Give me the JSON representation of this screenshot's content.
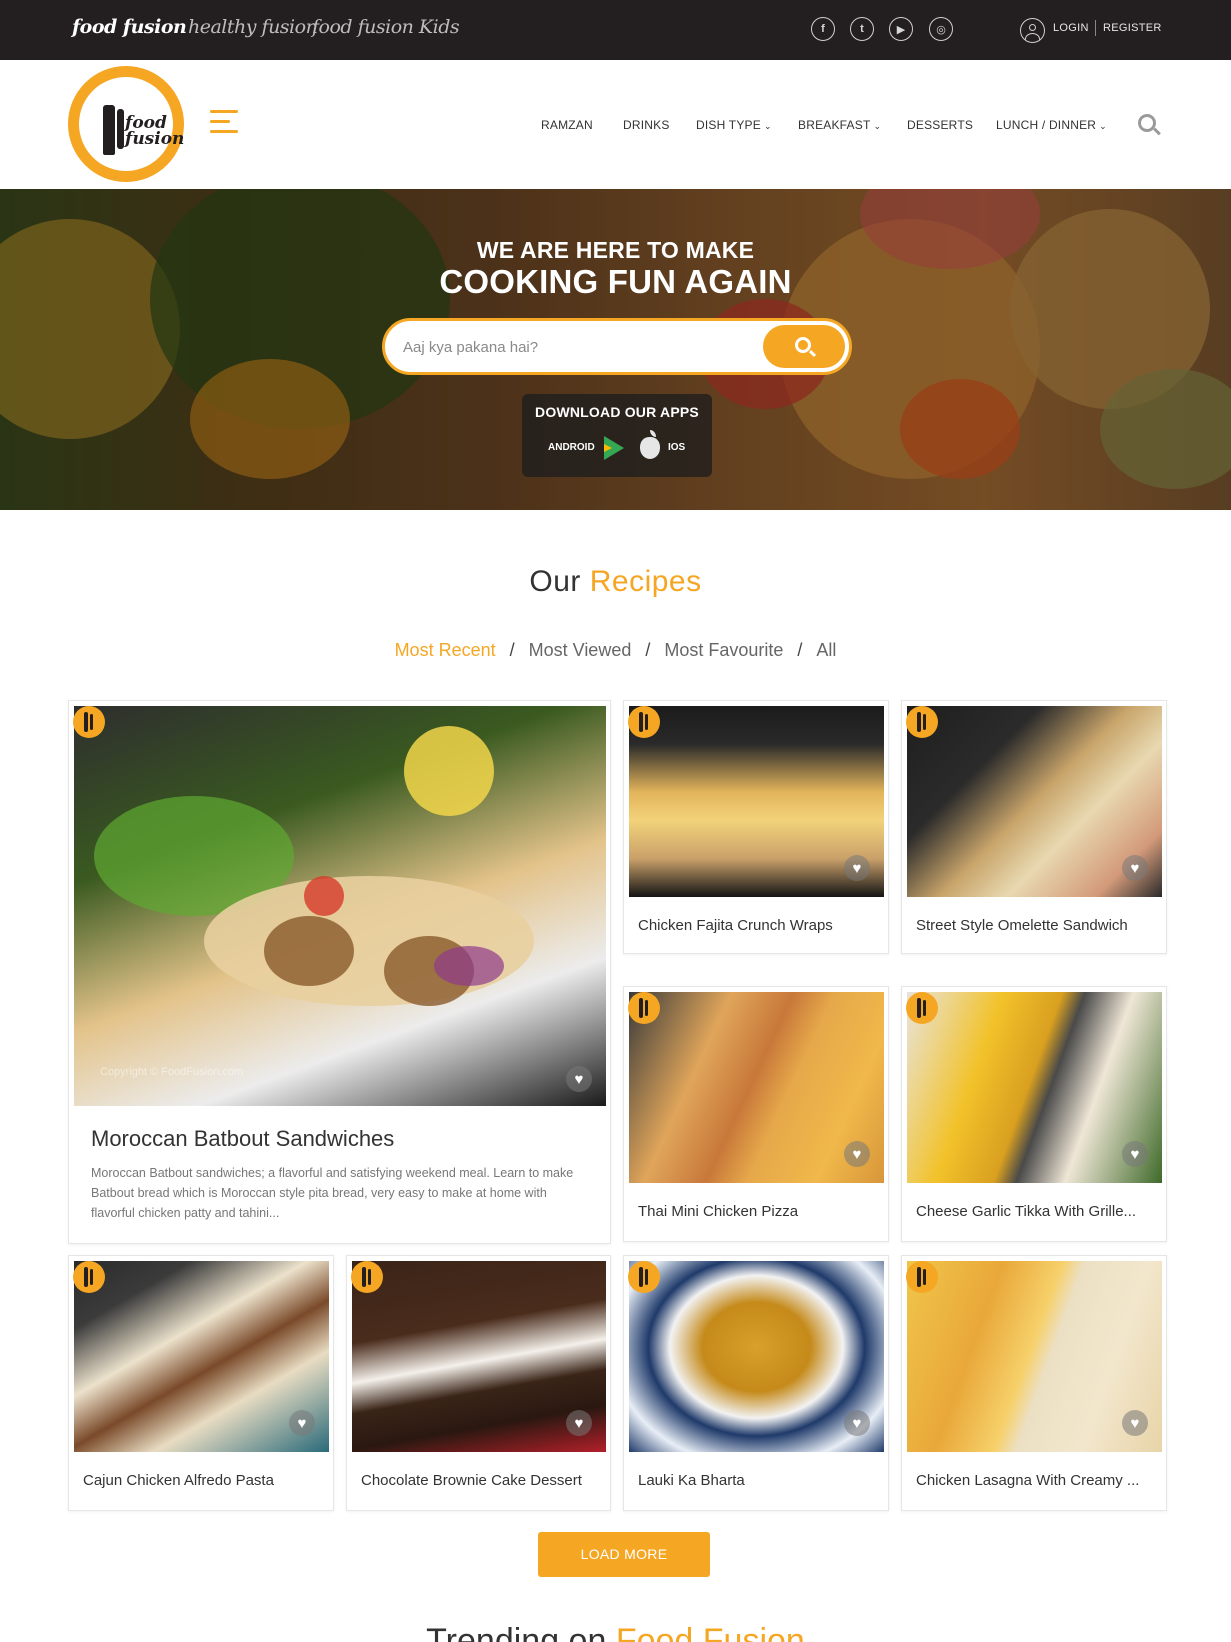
{
  "topbar": {
    "brands": [
      "food fusion",
      "healthy fusion",
      "food fusion Kids"
    ],
    "social": [
      {
        "icon": "facebook-icon",
        "glyph": "f"
      },
      {
        "icon": "twitter-icon",
        "glyph": "t"
      },
      {
        "icon": "youtube-icon",
        "glyph": "▶"
      },
      {
        "icon": "instagram-icon",
        "glyph": "◎"
      }
    ],
    "login": "LOGIN",
    "register": "REGISTER"
  },
  "logo": {
    "text_line1": "food",
    "text_line2": "fusion"
  },
  "nav": [
    {
      "label": "RAMZAN",
      "dropdown": false
    },
    {
      "label": "DRINKS",
      "dropdown": false
    },
    {
      "label": "DISH TYPE",
      "dropdown": true
    },
    {
      "label": "BREAKFAST",
      "dropdown": true
    },
    {
      "label": "DESSERTS",
      "dropdown": false
    },
    {
      "label": "LUNCH / DINNER",
      "dropdown": true
    }
  ],
  "hero": {
    "line1": "WE ARE HERE TO MAKE",
    "line2": "COOKING FUN AGAIN",
    "search_placeholder": "Aaj kya pakana hai?",
    "apps_title": "DOWNLOAD OUR APPS",
    "android_label": "ANDROID",
    "ios_label": "IOS"
  },
  "recipes": {
    "title_plain": "Our",
    "title_accent": "Recipes",
    "filters": [
      "Most Recent",
      "Most Viewed",
      "Most Favourite",
      "All"
    ],
    "active_filter": "Most Recent",
    "featured": {
      "title": "Moroccan Batbout Sandwiches",
      "description": "Moroccan Batbout sandwiches; a flavorful and satisfying weekend meal. Learn to make Batbout bread which is Moroccan style pita bread, very easy to make at home with flavorful chicken patty and tahini...",
      "watermark": "Copyright © FoodFusion.com"
    },
    "cards": [
      {
        "title": "Chicken Fajita Crunch Wraps"
      },
      {
        "title": "Street Style Omelette Sandwich"
      },
      {
        "title": "Thai Mini Chicken Pizza"
      },
      {
        "title": "Cheese Garlic Tikka With Grille..."
      },
      {
        "title": "Cajun Chicken Alfredo Pasta"
      },
      {
        "title": "Chocolate Brownie Cake Dessert"
      },
      {
        "title": "Lauki Ka Bharta"
      },
      {
        "title": "Chicken Lasagna With Creamy ..."
      }
    ],
    "load_more": "LOAD MORE"
  },
  "trending": {
    "title_plain": "Trending on",
    "title_accent": "Food Fusion"
  },
  "colors": {
    "accent": "#f5a623",
    "topbar": "#231f20"
  }
}
